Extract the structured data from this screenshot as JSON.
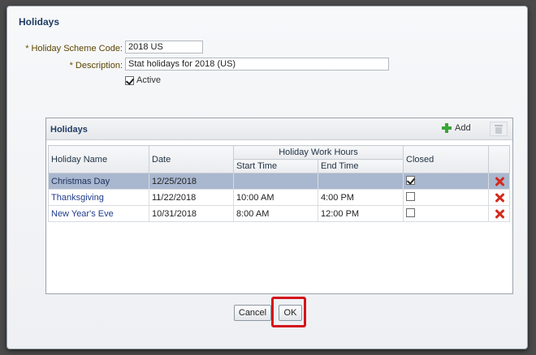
{
  "dialog": {
    "title": "Holidays",
    "fields": {
      "scheme_code": {
        "label": "Holiday Scheme Code:",
        "value": "2018 US"
      },
      "description": {
        "label": "Description:",
        "value": "Stat holidays for 2018 (US)"
      },
      "active": {
        "label": "Active",
        "checked": true
      },
      "required_marker": "*"
    },
    "panel": {
      "title": "Holidays",
      "add_label": "Add",
      "columns": {
        "holiday_name": "Holiday Name",
        "date": "Date",
        "work_hours": "Holiday Work Hours",
        "start_time": "Start Time",
        "end_time": "End Time",
        "closed": "Closed"
      },
      "rows": [
        {
          "name": "Christmas Day",
          "date": "12/25/2018",
          "start": "",
          "end": "",
          "closed": true,
          "selected": true
        },
        {
          "name": "Thanksgiving",
          "date": "11/22/2018",
          "start": "10:00 AM",
          "end": "4:00 PM",
          "closed": false,
          "selected": false
        },
        {
          "name": "New Year's Eve",
          "date": "10/31/2018",
          "start": "8:00 AM",
          "end": "12:00 PM",
          "closed": false,
          "selected": false
        }
      ]
    },
    "buttons": {
      "cancel": "Cancel",
      "ok": "OK"
    },
    "colors": {
      "highlight": "#d4141b",
      "selected_row": "#a9b7cf",
      "delete_icon": "#d42a1c",
      "add_icon": "#3aa63a"
    }
  }
}
